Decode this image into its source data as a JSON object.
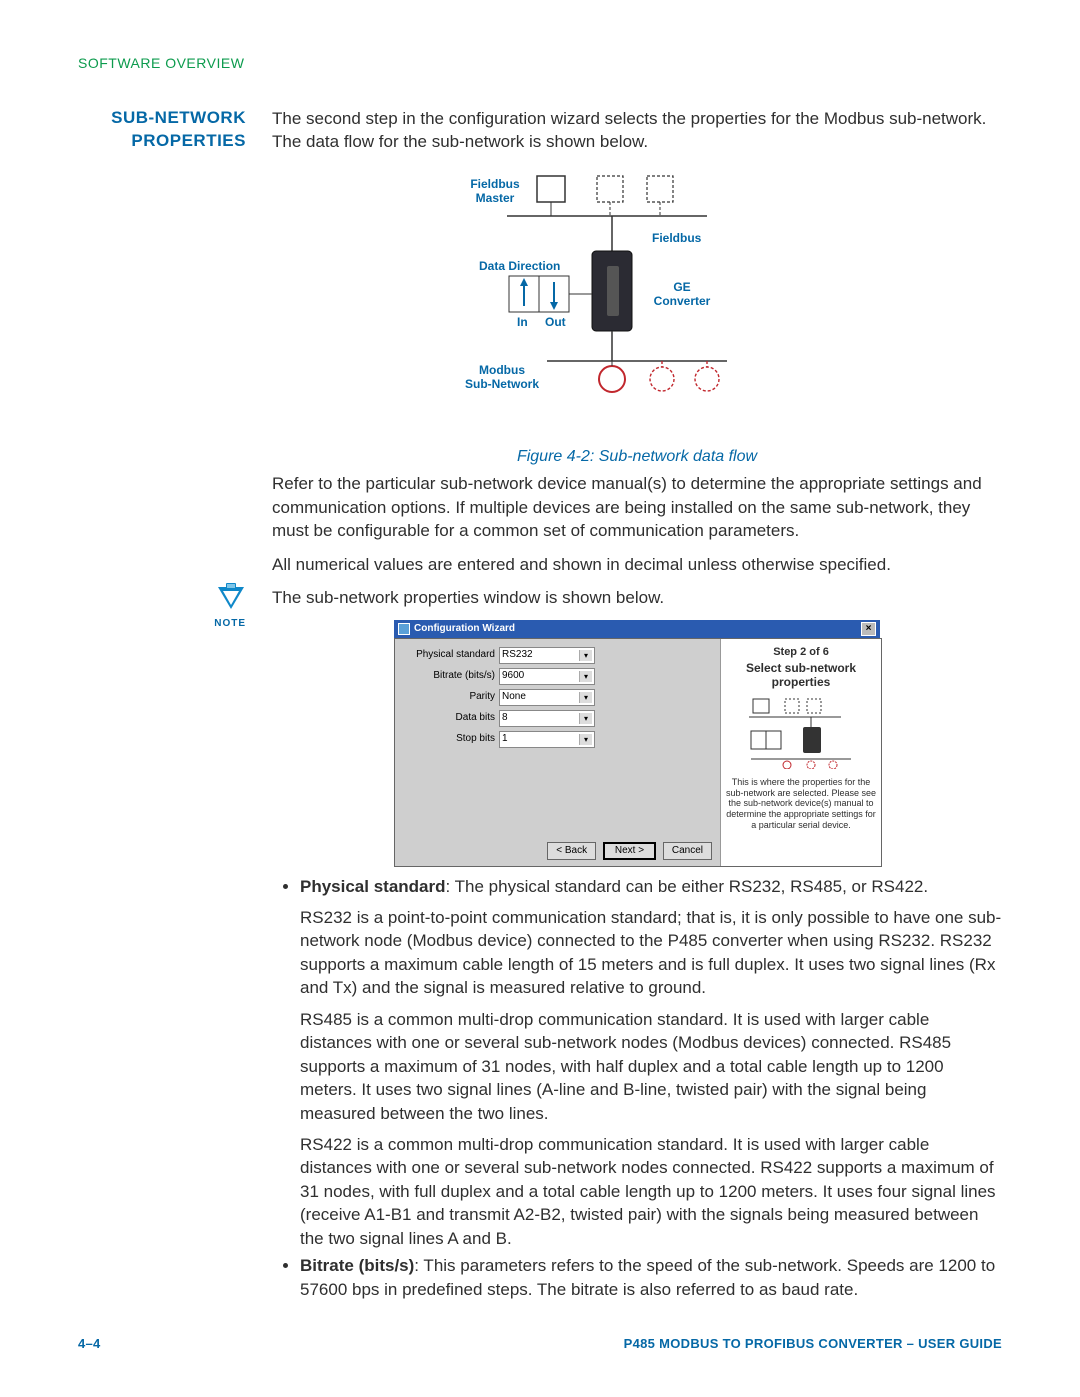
{
  "header": {
    "breadcrumb": "SOFTWARE OVERVIEW"
  },
  "section": {
    "heading_l1": "SUB-NETWORK",
    "heading_l2": "PROPERTIES",
    "note_label": "NOTE"
  },
  "body": {
    "p1": "The second step in the configuration wizard selects the properties for the Modbus sub-network. The data flow for the sub-network is shown below.",
    "fig_caption": "Figure 4-2: Sub-network data flow",
    "p2": "Refer to the particular sub-network device manual(s) to determine the appropriate settings and communication options. If multiple devices are being installed on the same sub-network, they must be configurable for a common set of communication parameters.",
    "p3": "All numerical values are entered and shown in decimal unless otherwise specified.",
    "p4": "The sub-network properties window is shown below.",
    "bullet1_lead": "Physical standard",
    "bullet1_rest": ": The physical standard can be either RS232, RS485, or RS422.",
    "bullet1_a": "RS232 is a point-to-point communication standard; that is, it is only possible to have one sub-network node (Modbus device) connected to the P485 converter when using RS232. RS232 supports a maximum cable length of 15 meters and is full duplex. It uses two signal lines (Rx and Tx) and the signal is measured relative to ground.",
    "bullet1_b": "RS485 is a common multi-drop communication standard. It is used with larger cable distances with one or several sub-network nodes (Modbus devices) connected. RS485 supports a maximum of 31 nodes, with half duplex and a total cable length up to 1200 meters. It uses two signal lines (A-line and B-line, twisted pair) with the signal being measured between the two lines.",
    "bullet1_c": "RS422 is a common multi-drop communication standard. It is used with larger cable distances with one or several sub-network nodes connected. RS422 supports a maximum of 31 nodes, with full duplex and a total cable length up to 1200 meters. It uses four signal lines (receive A1-B1 and transmit A2-B2, twisted pair) with the signals being measured between the two signal lines A and B.",
    "bullet2_lead": "Bitrate (bits/s)",
    "bullet2_rest": ": This parameters refers to the speed of the sub-network. Speeds are 1200 to 57600 bps in predefined steps. The bitrate is also referred to as baud rate."
  },
  "diagram": {
    "fieldbus_master": "Fieldbus\nMaster",
    "fieldbus": "Fieldbus",
    "data_direction": "Data  Direction",
    "in": "In",
    "out": "Out",
    "ge_converter": "GE\nConverter",
    "modbus_sub": "Modbus\nSub-Network"
  },
  "wizard": {
    "title": "Configuration Wizard",
    "fields": {
      "physical_standard": {
        "label": "Physical standard",
        "value": "RS232"
      },
      "bitrate": {
        "label": "Bitrate (bits/s)",
        "value": "9600"
      },
      "parity": {
        "label": "Parity",
        "value": "None"
      },
      "data_bits": {
        "label": "Data bits",
        "value": "8"
      },
      "stop_bits": {
        "label": "Stop bits",
        "value": "1"
      }
    },
    "buttons": {
      "back": "< Back",
      "next": "Next >",
      "cancel": "Cancel"
    },
    "side": {
      "step": "Step 2 of 6",
      "heading": "Select sub-network properties",
      "desc": "This is where the properties for the sub-network are selected. Please see the sub-network device(s) manual to determine the appropriate settings for a particular serial device."
    }
  },
  "footer": {
    "page": "4–4",
    "doc": "P485 MODBUS TO PROFIBUS CONVERTER – USER GUIDE"
  }
}
